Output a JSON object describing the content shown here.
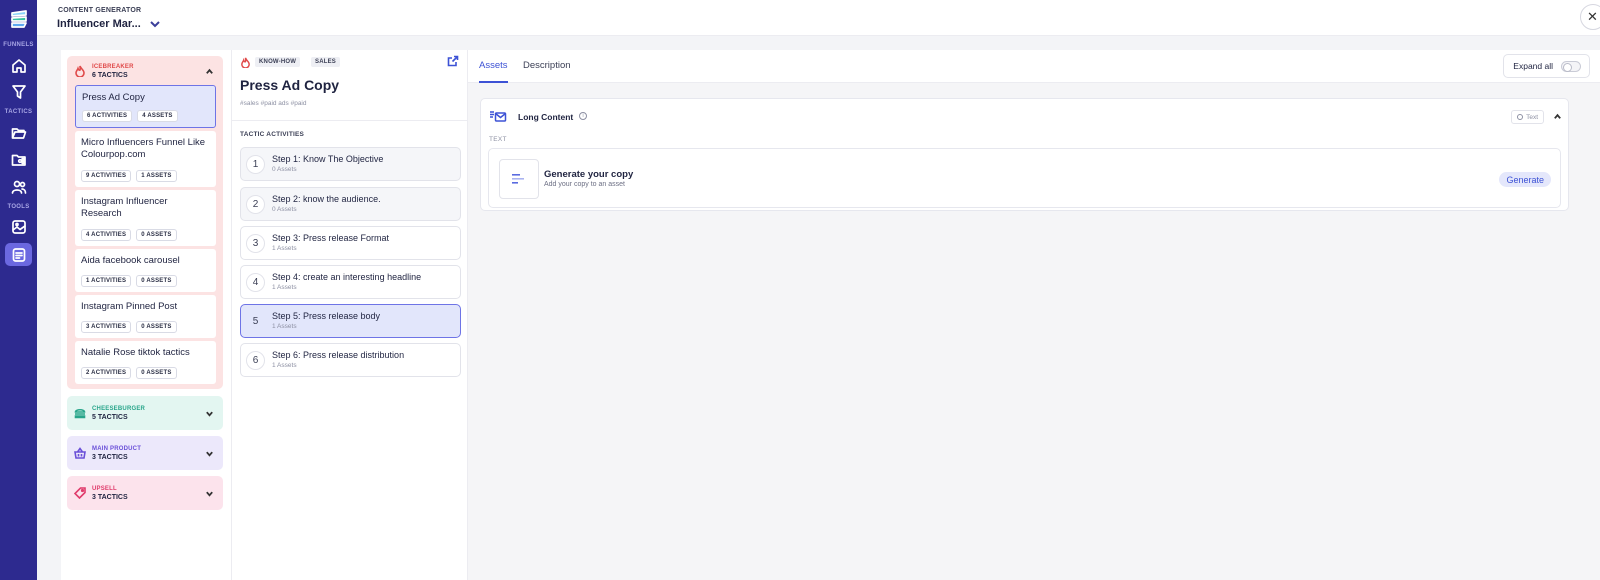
{
  "rail": {
    "sections": [
      "FUNNELS",
      "TACTICS",
      "TOOLS"
    ],
    "icons": [
      "home-icon",
      "funnel-icon",
      "folder-open-icon",
      "folder-shared-icon",
      "users-icon",
      "image-edit-icon",
      "content-generator-icon"
    ]
  },
  "header": {
    "caption": "CONTENT GENERATOR",
    "project": "Influencer Mar...",
    "close_glyph": "✕"
  },
  "tactics": {
    "groups": [
      {
        "name": "ICEBREAKER",
        "count": "6 TACTICS",
        "color": "#e04a4a",
        "expanded": true
      },
      {
        "name": "CHEESEBURGER",
        "count": "5 TACTICS",
        "color": "#28a58a",
        "expanded": false
      },
      {
        "name": "MAIN PRODUCT",
        "count": "3 TACTICS",
        "color": "#6a4fd8",
        "expanded": false
      },
      {
        "name": "UPSELL",
        "count": "3 TACTICS",
        "color": "#e03b6b",
        "expanded": false
      }
    ],
    "items": [
      {
        "title": "Press Ad Copy",
        "activities": "6 ACTIVITIES",
        "assets": "4 ASSETS",
        "selected": true
      },
      {
        "title": "Micro Influencers Funnel Like Colourpop.com",
        "activities": "9 ACTIVITIES",
        "assets": "1 ASSETS"
      },
      {
        "title": "Instagram Influencer Research",
        "activities": "4 ACTIVITIES",
        "assets": "0 ASSETS"
      },
      {
        "title": "Aida facebook carousel",
        "activities": "1 ACTIVITIES",
        "assets": "0 ASSETS"
      },
      {
        "title": "Instagram Pinned Post",
        "activities": "3 ACTIVITIES",
        "assets": "0 ASSETS"
      },
      {
        "title": "Natalie Rose tiktok tactics",
        "activities": "2 ACTIVITIES",
        "assets": "0 ASSETS"
      }
    ]
  },
  "detail": {
    "tags": [
      "KNOW-HOW",
      "SALES"
    ],
    "title": "Press Ad Copy",
    "hashtags": "#sales #paid ads #paid",
    "activities_label": "TACTIC ACTIVITIES",
    "steps": [
      {
        "num": "1",
        "title": "Step 1: Know The Objective",
        "assets": "0 Assets"
      },
      {
        "num": "2",
        "title": "Step 2: know the audience.",
        "assets": "0 Assets"
      },
      {
        "num": "3",
        "title": "Step 3: Press release Format",
        "assets": "1 Assets"
      },
      {
        "num": "4",
        "title": "Step 4: create an interesting headline",
        "assets": "1 Assets"
      },
      {
        "num": "5",
        "title": "Step 5: Press release body",
        "assets": "1 Assets",
        "active": true
      },
      {
        "num": "6",
        "title": "Step 6: Press release distribution",
        "assets": "1 Assets"
      }
    ]
  },
  "panel": {
    "tabs": [
      {
        "label": "Assets",
        "active": true
      },
      {
        "label": "Description",
        "active": false
      }
    ],
    "expand_all": "Expand all",
    "asset": {
      "name": "Long Content",
      "info": "i",
      "type_badge": "Text",
      "section_label": "TEXT",
      "gen_title": "Generate your copy",
      "gen_subtitle": "Add your copy to an asset",
      "gen_button": "Generate"
    }
  },
  "colors": {
    "rail": "#2d2a8f",
    "accent": "#3d52d5",
    "selected": "#e2e6fb"
  }
}
